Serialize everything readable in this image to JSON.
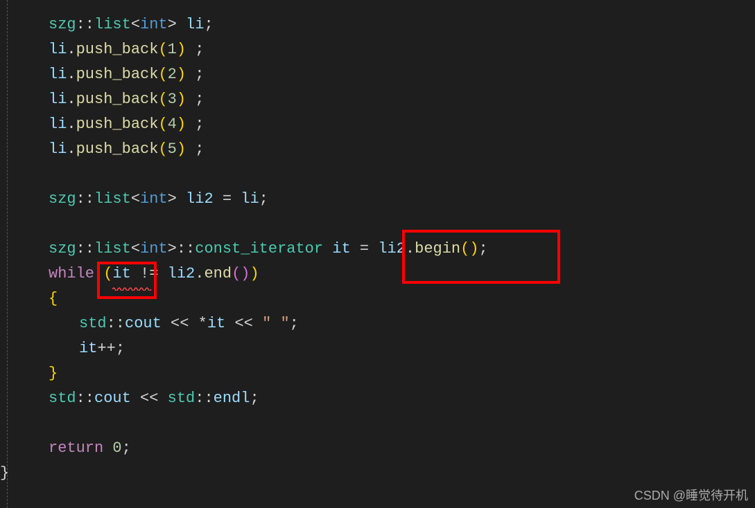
{
  "code": {
    "l1": {
      "ns": "szg",
      "scope": "::",
      "tpl": "list",
      "open": "<",
      "type": "int",
      "close": ">",
      "sp": " ",
      "var": "li",
      "end": ";"
    },
    "l2": {
      "var": "li",
      "dot": ".",
      "func": "push_back",
      "lp": "(",
      "num": "1",
      "rp": ")",
      "sp": " ",
      "end": ";"
    },
    "l3": {
      "var": "li",
      "dot": ".",
      "func": "push_back",
      "lp": "(",
      "num": "2",
      "rp": ")",
      "sp": " ",
      "end": ";"
    },
    "l4": {
      "var": "li",
      "dot": ".",
      "func": "push_back",
      "lp": "(",
      "num": "3",
      "rp": ")",
      "sp": " ",
      "end": ";"
    },
    "l5": {
      "var": "li",
      "dot": ".",
      "func": "push_back",
      "lp": "(",
      "num": "4",
      "rp": ")",
      "sp": " ",
      "end": ";"
    },
    "l6": {
      "var": "li",
      "dot": ".",
      "func": "push_back",
      "lp": "(",
      "num": "5",
      "rp": ")",
      "sp": " ",
      "end": ";"
    },
    "l7": {
      "ns": "szg",
      "scope": "::",
      "tpl": "list",
      "open": "<",
      "type": "int",
      "close": ">",
      "sp": " ",
      "var": "li2",
      "eq": " = ",
      "rhs": "li",
      "end": ";"
    },
    "l8": {
      "ns": "szg",
      "scope1": "::",
      "tpl": "list",
      "open": "<",
      "type": "int",
      "close": ">",
      "scope2": "::",
      "iterator": "const_iterator",
      "sp": " ",
      "var": "it",
      "eq": " = ",
      "rhs": "li2",
      "dot": ".",
      "func": "begin",
      "lp": "(",
      "rp": ")",
      "end": ";"
    },
    "l9": {
      "kw": "while",
      "sp": " ",
      "lp": "(",
      "it": "it",
      "ne": " != ",
      "var": "li2",
      "dot": ".",
      "func": "end",
      "lp2": "(",
      "rp2": ")",
      "rp": ")"
    },
    "l10": {
      "brace": "{"
    },
    "l11": {
      "ns": "std",
      "scope": "::",
      "cout": "cout",
      "sp": " ",
      "op1": "<<",
      "sp2": " ",
      "star": "*",
      "it": "it",
      "sp3": " ",
      "op2": "<<",
      "sp4": " ",
      "str": "\" \"",
      "end": ";"
    },
    "l12": {
      "it": "it",
      "op": "++",
      "end": ";"
    },
    "l13": {
      "brace": "}"
    },
    "l14": {
      "ns": "std",
      "scope": "::",
      "cout": "cout",
      "sp": " ",
      "op": "<<",
      "sp2": " ",
      "ns2": "std",
      "scope2": "::",
      "endl": "endl",
      "end": ";"
    },
    "l15": {
      "kw": "return",
      "sp": " ",
      "num": "0",
      "end": ";"
    },
    "l16": {
      "brace": "}"
    }
  },
  "watermark": "CSDN @睡觉待开机"
}
